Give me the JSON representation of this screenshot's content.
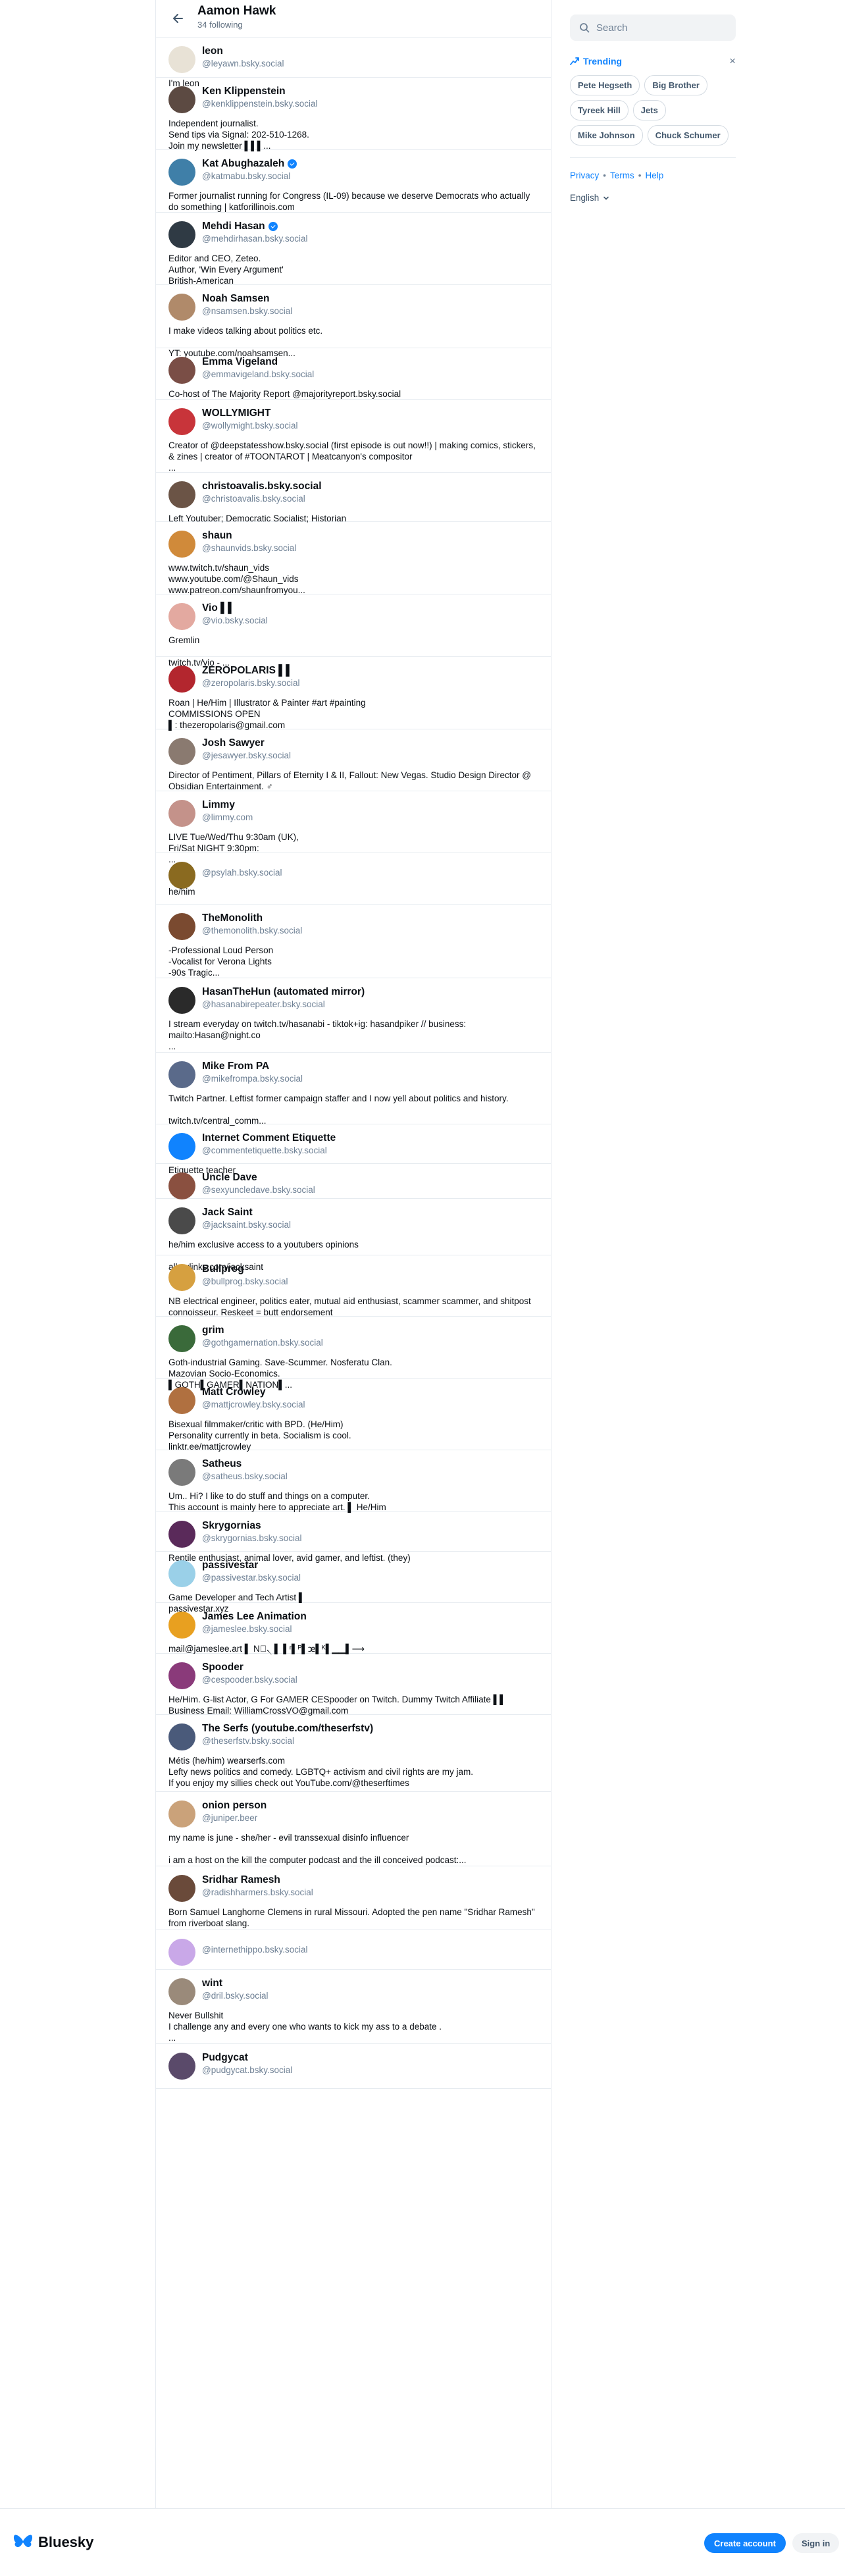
{
  "header": {
    "title": "Aamon Hawk",
    "subtitle": "34 following"
  },
  "search": {
    "placeholder": "Search"
  },
  "trending": {
    "label": "Trending",
    "topics": [
      "Pete Hegseth",
      "Big Brother",
      "Tyreek Hill",
      "Jets",
      "Mike Johnson",
      "Chuck Schumer"
    ]
  },
  "footer_links": {
    "privacy": "Privacy",
    "terms": "Terms",
    "help": "Help",
    "sep": "•"
  },
  "language": "English",
  "brand": "Bluesky",
  "buttons": {
    "create_account": "Create account",
    "sign_in": "Sign in"
  },
  "colors": {
    "accent": "#1083fe"
  },
  "follows": [
    {
      "name": "leon",
      "handle": "@leyawn.bsky.social",
      "bio": "I'm leon",
      "verified": false,
      "avatar_color": "#e8e2d6"
    },
    {
      "name": "Ken Klippenstein",
      "handle": "@kenklippenstein.bsky.social",
      "bio": "Independent journalist.\nSend tips via Signal: 202-510-1268.\nJoin my newsletter ▌▌▌...",
      "verified": false,
      "avatar_color": "#5c4a42"
    },
    {
      "name": "Kat Abughazaleh",
      "handle": "@katmabu.bsky.social",
      "bio": "Former journalist running for Congress (IL-09) because we deserve Democrats who actually do something | katforillinois.com",
      "verified": true,
      "avatar_color": "#3f7fa8"
    },
    {
      "name": "Mehdi Hasan",
      "handle": "@mehdirhasan.bsky.social",
      "bio": "Editor and CEO, Zeteo.\nAuthor, 'Win Every Argument'\nBritish-American",
      "verified": true,
      "avatar_color": "#2f3a44"
    },
    {
      "name": "Noah Samsen",
      "handle": "@nsamsen.bsky.social",
      "bio": "I make videos talking about politics etc.\n\nYT: youtube.com/noahsamsen...",
      "verified": false,
      "avatar_color": "#b08a6a"
    },
    {
      "name": "Emma Vigeland",
      "handle": "@emmavigeland.bsky.social",
      "bio": "Co-host of The Majority Report @majorityreport.bsky.social",
      "verified": false,
      "avatar_color": "#7a4e46"
    },
    {
      "name": "WOLLYMIGHT",
      "handle": "@wollymight.bsky.social",
      "bio": "Creator of @deepstatesshow.bsky.social (first episode is out now!!) | making comics, stickers, & zines | creator of #TOONTAROT | Meatcanyon's compositor\n...",
      "verified": false,
      "avatar_color": "#c8343a"
    },
    {
      "name": "christoavalis.bsky.social",
      "handle": "@christoavalis.bsky.social",
      "bio": "Left Youtuber; Democratic Socialist; Historian",
      "verified": false,
      "avatar_color": "#6b5446"
    },
    {
      "name": "shaun",
      "handle": "@shaunvids.bsky.social",
      "bio": "www.twitch.tv/shaun_vids\nwww.youtube.com/@Shaun_vids\nwww.patreon.com/shaunfromyou...",
      "verified": false,
      "avatar_color": "#d08a3a"
    },
    {
      "name": "Vio ▌▌",
      "handle": "@vio.bsky.social",
      "bio": "Gremlin\n\ntwitch.tv/vio - ...",
      "verified": false,
      "avatar_color": "#e3a9a0"
    },
    {
      "name": "ZEROPOLARIS ▌▌",
      "handle": "@zeropolaris.bsky.social",
      "bio": "Roan | He/Him | Illustrator & Painter #art #painting\nCOMMISSIONS OPEN\n▌: thezeropolaris@gmail.com",
      "verified": false,
      "avatar_color": "#b3262e"
    },
    {
      "name": "Josh Sawyer",
      "handle": "@jesawyer.bsky.social",
      "bio": "Director of Pentiment, Pillars of Eternity I & II, Fallout: New Vegas. Studio Design Director @ Obsidian Entertainment. ♂",
      "verified": false,
      "avatar_color": "#8a7a70"
    },
    {
      "name": "Limmy",
      "handle": "@limmy.com",
      "bio": "LIVE Tue/Wed/Thu 9:30am (UK),\nFri/Sat NIGHT 9:30pm:\n...",
      "verified": false,
      "avatar_color": "#c4928a"
    },
    {
      "name": "",
      "handle": "@psylah.bsky.social",
      "bio": "he/him",
      "verified": false,
      "avatar_color": "#8a6a20"
    },
    {
      "name": "TheMonolith",
      "handle": "@themonolith.bsky.social",
      "bio": "-Professional Loud Person\n-Vocalist for Verona Lights\n-90s Tragic...",
      "verified": false,
      "avatar_color": "#7a4a30"
    },
    {
      "name": "HasanTheHun (automated mirror)",
      "handle": "@hasanabirepeater.bsky.social",
      "bio": "I stream everyday on twitch.tv/hasanabi - tiktok+ig: hasandpiker // business: mailto:Hasan@night.co\n...",
      "verified": false,
      "avatar_color": "#2a2a2a"
    },
    {
      "name": "Mike From PA",
      "handle": "@mikefrompa.bsky.social",
      "bio": "Twitch Partner. Leftist former campaign staffer and I now yell about politics and history.\n\ntwitch.tv/central_comm...",
      "verified": false,
      "avatar_color": "#5a6a8a"
    },
    {
      "name": "Internet Comment Etiquette",
      "handle": "@commentetiquette.bsky.social",
      "bio": "Etiquette teacher",
      "verified": false,
      "avatar_color": "#1083fe"
    },
    {
      "name": "Uncle Dave",
      "handle": "@sexyuncledave.bsky.social",
      "bio": "",
      "verified": false,
      "avatar_color": "#8a5040"
    },
    {
      "name": "Jack Saint",
      "handle": "@jacksaint.bsky.social",
      "bio": "he/him  exclusive access to a youtubers opinions\n\nallmylinks.com/jacksaint",
      "verified": false,
      "avatar_color": "#4a4a4a"
    },
    {
      "name": "Bullprog",
      "handle": "@bullprog.bsky.social",
      "bio": "NB electrical engineer, politics eater, mutual aid enthusiast, scammer scammer, and shitpost connoisseur. Reskeet = butt endorsement",
      "verified": false,
      "avatar_color": "#d6a040"
    },
    {
      "name": "grim",
      "handle": "@gothgamernation.bsky.social",
      "bio": "Goth-industrial Gaming. Save-Scummer. Nosferatu Clan.\nMazovian Socio-Economics.\n▌GOTH▌GAMER▌NATION▌...",
      "verified": false,
      "avatar_color": "#3a6a3a"
    },
    {
      "name": "Matt Crowley",
      "handle": "@mattjcrowley.bsky.social",
      "bio": "Bisexual filmmaker/critic with BPD. (He/Him)\nPersonality currently in beta. Socialism is cool.\nlinktr.ee/mattjcrowley",
      "verified": false,
      "avatar_color": "#b07040"
    },
    {
      "name": "Satheus",
      "handle": "@satheus.bsky.social",
      "bio": "Um.. Hi? I like to do stuff and things on a computer.\nThis account is mainly here to appreciate art. ▌ He/Him",
      "verified": false,
      "avatar_color": "#7a7a7a"
    },
    {
      "name": "Skrygornias",
      "handle": "@skrygornias.bsky.social",
      "bio": "Reptile enthusiast, animal lover, avid gamer, and leftist. (they)",
      "verified": false,
      "avatar_color": "#5a2a5a"
    },
    {
      "name": "passivestar",
      "handle": "@passivestar.bsky.social",
      "bio": "Game Developer and Tech Artist ▌\npassivestar.xyz",
      "verified": false,
      "avatar_color": "#9ad0e8"
    },
    {
      "name": "James Lee Animation",
      "handle": "@jameslee.bsky.social",
      "bio": "mail@jameslee.art  ▌ N⃝৲  ▌ ▌ʳ▌ᴾ▌ꭢ▌ᴷ▌▁▁▌⟶",
      "verified": false,
      "avatar_color": "#e8a020"
    },
    {
      "name": "Spooder",
      "handle": "@cespooder.bsky.social",
      "bio": "He/Him. G-list Actor, G For GAMER CESpooder on Twitch. Dummy Twitch Affiliate ▌▌\nBusiness Email: WilliamCrossVO@gmail.com",
      "verified": false,
      "avatar_color": "#8a3a7a"
    },
    {
      "name": "The Serfs (youtube.com/theserfstv)",
      "handle": "@theserfstv.bsky.social",
      "bio": "Métis (he/him) wearserfs.com\nLefty news politics and comedy. LGBTQ+ activism and civil rights are my jam.\nIf you enjoy my sillies check out YouTube.com/@theserftimes",
      "verified": false,
      "avatar_color": "#4a5a7a"
    },
    {
      "name": "onion person",
      "handle": "@juniper.beer",
      "bio": "my name is june - she/her - evil transsexual disinfo influencer\n\ni am a host on the kill the computer podcast and the ill conceived podcast:...",
      "verified": false,
      "avatar_color": "#caa27a"
    },
    {
      "name": "Sridhar Ramesh",
      "handle": "@radishharmers.bsky.social",
      "bio": "Born Samuel Langhorne Clemens in rural Missouri. Adopted the pen name \"Sridhar Ramesh\" from riverboat slang.",
      "verified": false,
      "avatar_color": "#6a4a3a"
    },
    {
      "name": "",
      "handle": "@internethippo.bsky.social",
      "bio": "",
      "verified": false,
      "avatar_color": "#c9a8e8"
    },
    {
      "name": "wint",
      "handle": "@dril.bsky.social",
      "bio": "Never Bullshit\nI challenge any and every one who wants to kick my ass to a debate .\n...",
      "verified": false,
      "avatar_color": "#9a8a7a"
    },
    {
      "name": "Pudgycat",
      "handle": "@pudgycat.bsky.social",
      "bio": "",
      "verified": false,
      "avatar_color": "#5a4a6a"
    }
  ]
}
